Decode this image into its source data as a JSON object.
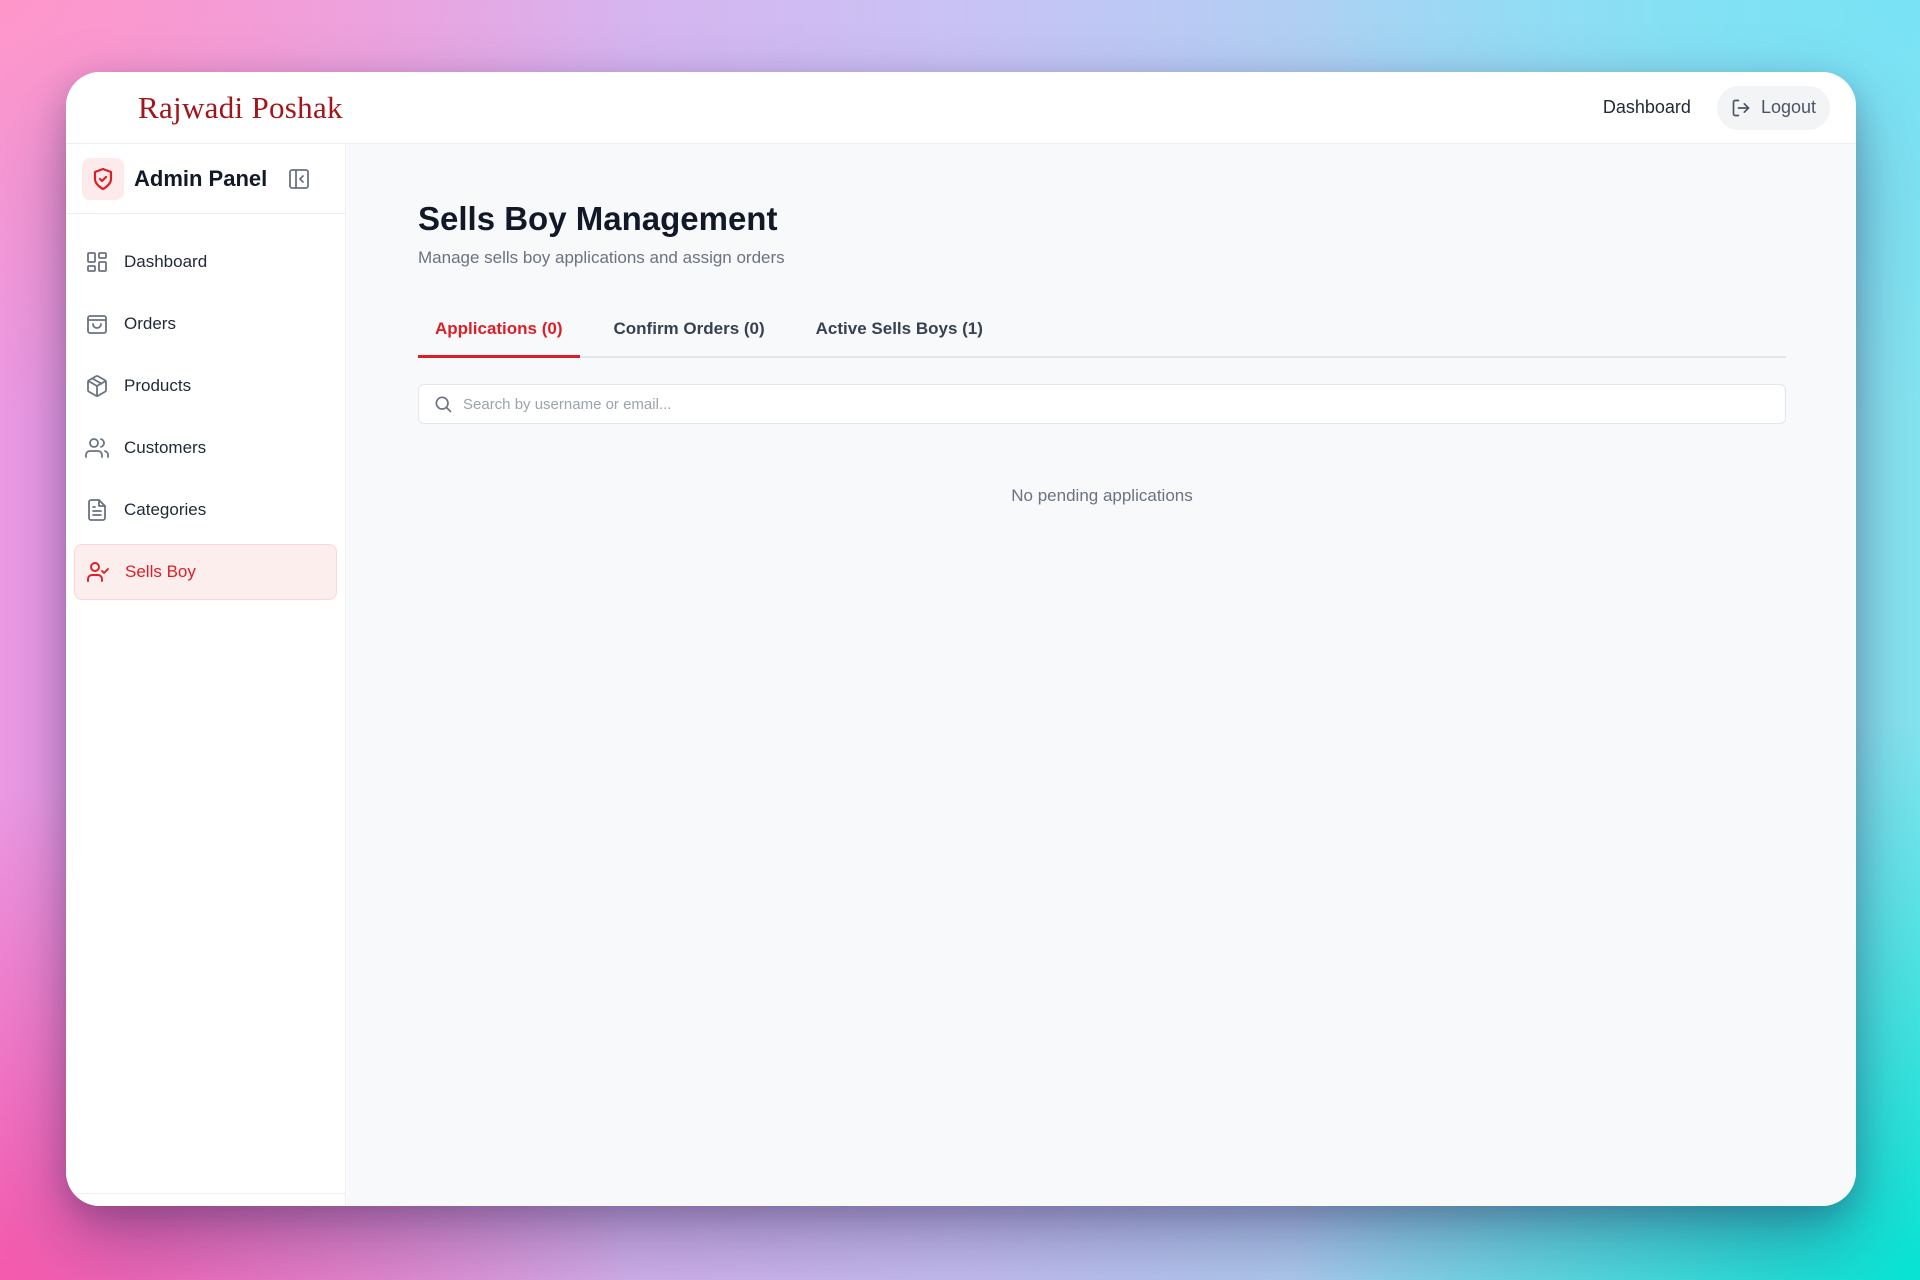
{
  "brand": {
    "name": "Rajwadi Poshak"
  },
  "topbar": {
    "dashboard_link": "Dashboard",
    "logout_label": "Logout"
  },
  "sidebar": {
    "title": "Admin Panel",
    "items": [
      {
        "label": "Dashboard",
        "icon": "dashboard-grid-icon"
      },
      {
        "label": "Orders",
        "icon": "shopping-bag-icon"
      },
      {
        "label": "Products",
        "icon": "package-icon"
      },
      {
        "label": "Customers",
        "icon": "users-icon"
      },
      {
        "label": "Categories",
        "icon": "document-icon"
      },
      {
        "label": "Sells Boy",
        "icon": "user-check-icon",
        "active": true
      }
    ]
  },
  "page": {
    "title": "Sells Boy Management",
    "subtitle": "Manage sells boy applications and assign orders"
  },
  "tabs": [
    {
      "label": "Applications (0)",
      "active": true
    },
    {
      "label": "Confirm Orders (0)"
    },
    {
      "label": "Active Sells Boys (1)"
    }
  ],
  "search": {
    "placeholder": "Search by username or email...",
    "value": ""
  },
  "empty_state": "No pending applications",
  "colors": {
    "accent": "#dc1f26",
    "brand": "#a3151b",
    "active_bg": "#fdeeee"
  }
}
